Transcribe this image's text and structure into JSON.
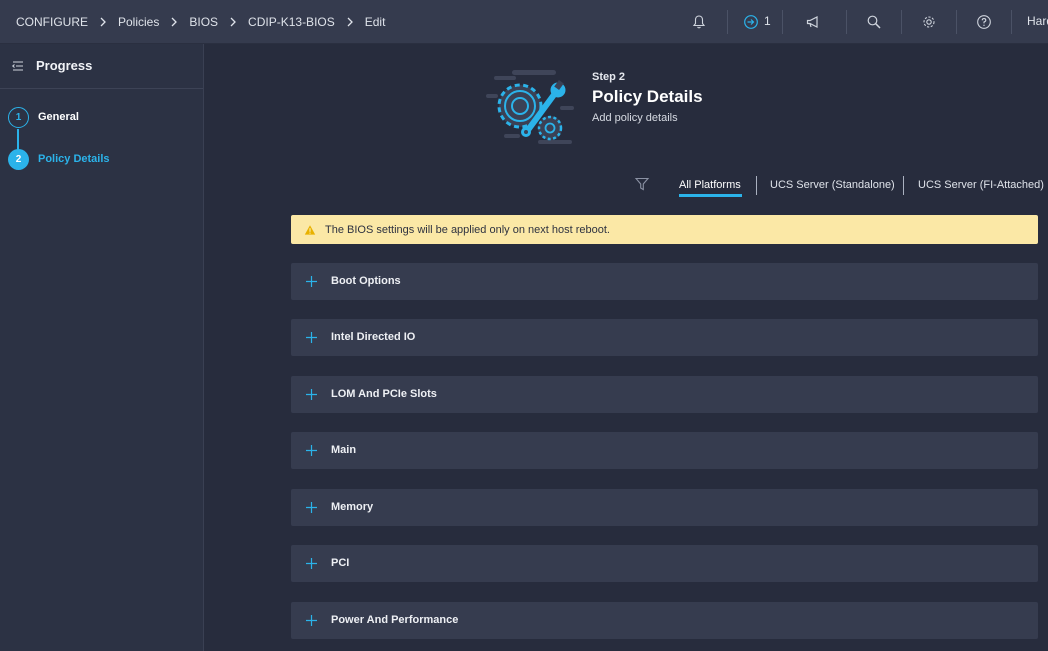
{
  "header": {
    "breadcrumb": [
      "CONFIGURE",
      "Policies",
      "BIOS",
      "CDIP-K13-BIOS",
      "Edit"
    ],
    "request_count": "1",
    "user_name": "Hard"
  },
  "sidebar": {
    "title": "Progress",
    "steps": [
      {
        "number": "1",
        "label": "General",
        "state": "done"
      },
      {
        "number": "2",
        "label": "Policy Details",
        "state": "active"
      }
    ]
  },
  "main": {
    "step_kicker": "Step 2",
    "title": "Policy Details",
    "subtitle": "Add policy details",
    "tabs": [
      "All Platforms",
      "UCS Server (Standalone)",
      "UCS Server (FI-Attached)"
    ],
    "active_tab": "All Platforms",
    "alert": "The BIOS settings will be applied only on next host reboot.",
    "sections": [
      "Boot Options",
      "Intel Directed IO",
      "LOM And PCIe Slots",
      "Main",
      "Memory",
      "PCI",
      "Power And Performance"
    ]
  },
  "colors": {
    "accent": "#2bb3ea",
    "topbar": "#353b4e",
    "background": "#272c3d",
    "sidebar": "#2c3244",
    "section": "#363c4f",
    "alert_bg": "#fbe8a6",
    "warning": "#e8b100"
  },
  "icons": {
    "topbar": [
      "bell-icon",
      "service-request-icon",
      "megaphone-icon",
      "search-icon",
      "gear-icon",
      "help-icon"
    ],
    "sidebar": "collapse-list-icon",
    "filter": "filter-icon",
    "alert": "warning-icon",
    "section": "plus-icon"
  }
}
